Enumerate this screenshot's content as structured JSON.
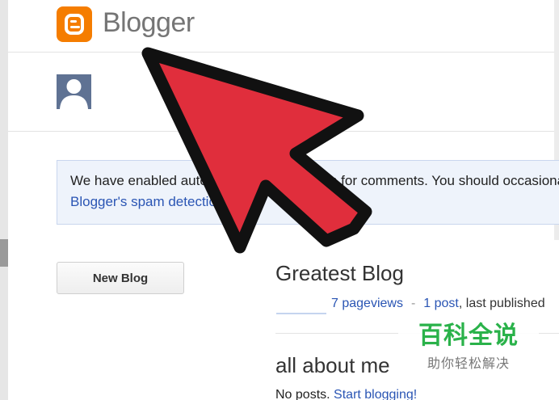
{
  "header": {
    "app_name": "Blogger",
    "logo_icon": "blogger-logo-icon"
  },
  "profile": {
    "avatar_icon": "default-avatar-icon"
  },
  "notice": {
    "line1": "We have enabled automatic spam detection for comments. You should occasionally check",
    "line2": "Blogger's spam detection report"
  },
  "actions": {
    "new_blog_label": "New Blog"
  },
  "blog": {
    "title": "Greatest Blog",
    "pageviews_label": "7 pageviews",
    "separator": "-",
    "posts_label": "1 post",
    "last_published": ", last published"
  },
  "section": {
    "title": "all about me",
    "no_posts_text": "No posts.",
    "start_blogging_label": "Start blogging!"
  },
  "watermark": {
    "title": "百科全说",
    "subtitle": "助你轻松解决"
  },
  "overlay": {
    "arrow_color": "#e02e3c",
    "arrow_icon": "red-pointer-arrow-icon"
  }
}
